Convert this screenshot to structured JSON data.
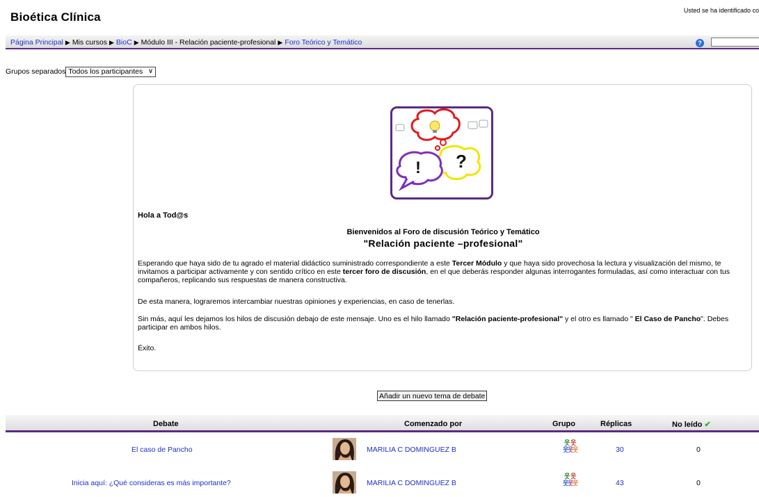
{
  "header": {
    "site_title": "Bioética Clínica",
    "login_info": "Usted se ha identificado co"
  },
  "breadcrumb": {
    "items": [
      {
        "label": "Página Principal",
        "link": true
      },
      {
        "label": "Mis cursos",
        "link": false
      },
      {
        "label": "BioC",
        "link": true
      },
      {
        "label": "Módulo III - Relación paciente-profesional",
        "link": false
      },
      {
        "label": "Foro Teórico y Temático",
        "link": true
      }
    ],
    "separator": "▶"
  },
  "groups": {
    "label": "Grupos separados",
    "selected": "Todos los participantes"
  },
  "intro": {
    "greeting": "Hola a Tod@s",
    "welcome": "Bienvenidos al Foro de discusión Teórico y Temático",
    "topic": "\"Relación paciente –profesional\"",
    "p1_a": "Esperando que haya sido de tu agrado el material didáctico suministrado correspondiente a este ",
    "p1_b": "Tercer Módulo",
    "p1_c": " y que haya sido provechosa la lectura y visualización del mismo, te invitamos a participar activamente y con sentido crítico en este ",
    "p1_d": "tercer foro de discusión",
    "p1_e": ", en el que deberás responder algunas interrogantes formuladas, así como interactuar con tus compañeros, replicando sus respuestas de manera constructiva.",
    "p2": "De esta manera, lograremos intercambiar nuestras opiniones y experiencias, en caso de tenerlas.",
    "p3_a": "Sin más, aquí les dejamos los hilos de discusión debajo de este mensaje. Uno es el hilo llamado ",
    "p3_b": "\"Relación paciente-profesional\"",
    "p3_c": " y el otro es llamado \" ",
    "p3_d": "El Caso de Pancho",
    "p3_e": "\". Debes participar en ambos hilos.",
    "p4": "Éxito."
  },
  "add_button_label": "Añadir un nuevo tema de debate",
  "table": {
    "headers": {
      "debate": "Debate",
      "started_by": "Comenzado por",
      "group": "Grupo",
      "replies": "Réplicas",
      "unread": "No leído"
    },
    "rows": [
      {
        "debate": "El caso de Pancho",
        "author": "MARILIA C DOMINGUEZ B",
        "replies": "30",
        "unread": "0"
      },
      {
        "debate": "Inicia aquí: ¿Qué consideras es más importante?",
        "author": "MARILIA C DOMINGUEZ B",
        "replies": "43",
        "unread": "0"
      }
    ]
  },
  "colors": {
    "accent_purple": "#5b2a86",
    "link_blue": "#1a2fcf",
    "checkmark_green": "#3aa636"
  }
}
